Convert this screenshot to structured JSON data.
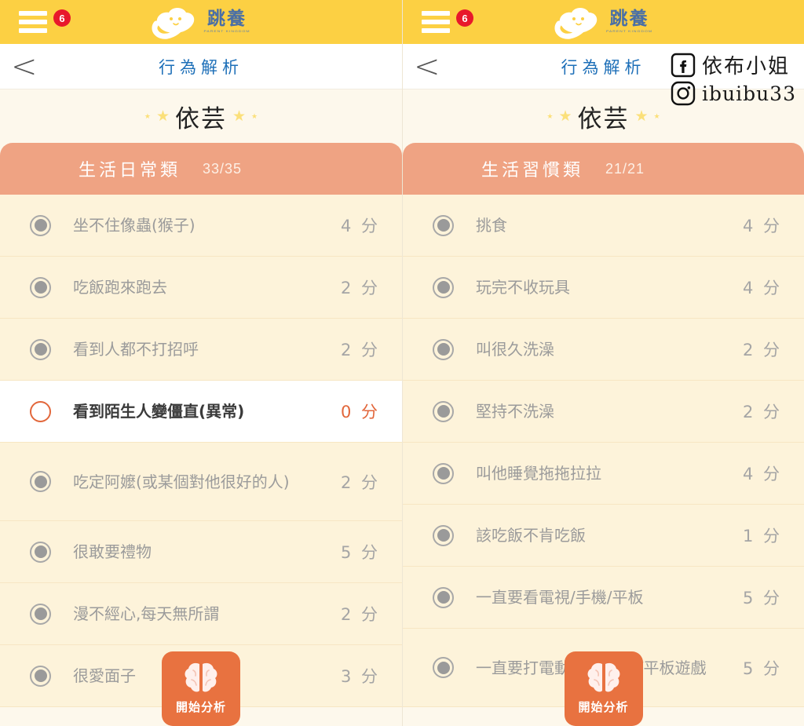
{
  "app": {
    "logo_cn": "跳養",
    "logo_en": "PARENT KINGDOM",
    "menu_badge": "6",
    "page_title": "行為解析",
    "back_label": "<"
  },
  "child": {
    "name": "依芸"
  },
  "analyze_button": {
    "label": "開始分析",
    "icon": "brain-icon",
    "color": "#e87240"
  },
  "watermark": {
    "facebook": {
      "icon": "facebook-icon",
      "handle": "依布小姐"
    },
    "instagram": {
      "icon": "instagram-icon",
      "handle": "ibuibu33"
    }
  },
  "colors": {
    "topbar": "#fcd043",
    "category_header": "#efa383",
    "page_bg": "#fdf8ec",
    "row_bg": "#fdf3da",
    "accent": "#e2663a",
    "title_blue": "#1d6fb8"
  },
  "score_unit": "分",
  "panels": [
    {
      "category": "生活日常類",
      "count": "33/35",
      "items": [
        {
          "label": "坐不住像蟲(猴子)",
          "score": "4",
          "selected": true
        },
        {
          "label": "吃飯跑來跑去",
          "score": "2",
          "selected": true
        },
        {
          "label": "看到人都不打招呼",
          "score": "2",
          "selected": true
        },
        {
          "label": "看到陌生人變僵直(異常)",
          "score": "0",
          "selected": false
        },
        {
          "label": "吃定阿嬤(或某個對他很好的人)",
          "score": "2",
          "selected": true
        },
        {
          "label": "很敢要禮物",
          "score": "5",
          "selected": true
        },
        {
          "label": "漫不經心,每天無所謂",
          "score": "2",
          "selected": true
        },
        {
          "label": "很愛面子",
          "score": "3",
          "selected": true
        }
      ]
    },
    {
      "category": "生活習慣類",
      "count": "21/21",
      "items": [
        {
          "label": "挑食",
          "score": "4",
          "selected": true
        },
        {
          "label": "玩完不收玩具",
          "score": "4",
          "selected": true
        },
        {
          "label": "叫很久洗澡",
          "score": "2",
          "selected": true
        },
        {
          "label": "堅持不洗澡",
          "score": "2",
          "selected": true
        },
        {
          "label": "叫他睡覺拖拖拉拉",
          "score": "4",
          "selected": true
        },
        {
          "label": "該吃飯不肯吃飯",
          "score": "1",
          "selected": true
        },
        {
          "label": "一直要看電視/手機/平板",
          "score": "5",
          "selected": true
        },
        {
          "label": "一直要打電動/手機遊戲/平板遊戲",
          "score": "5",
          "selected": true
        }
      ]
    }
  ]
}
